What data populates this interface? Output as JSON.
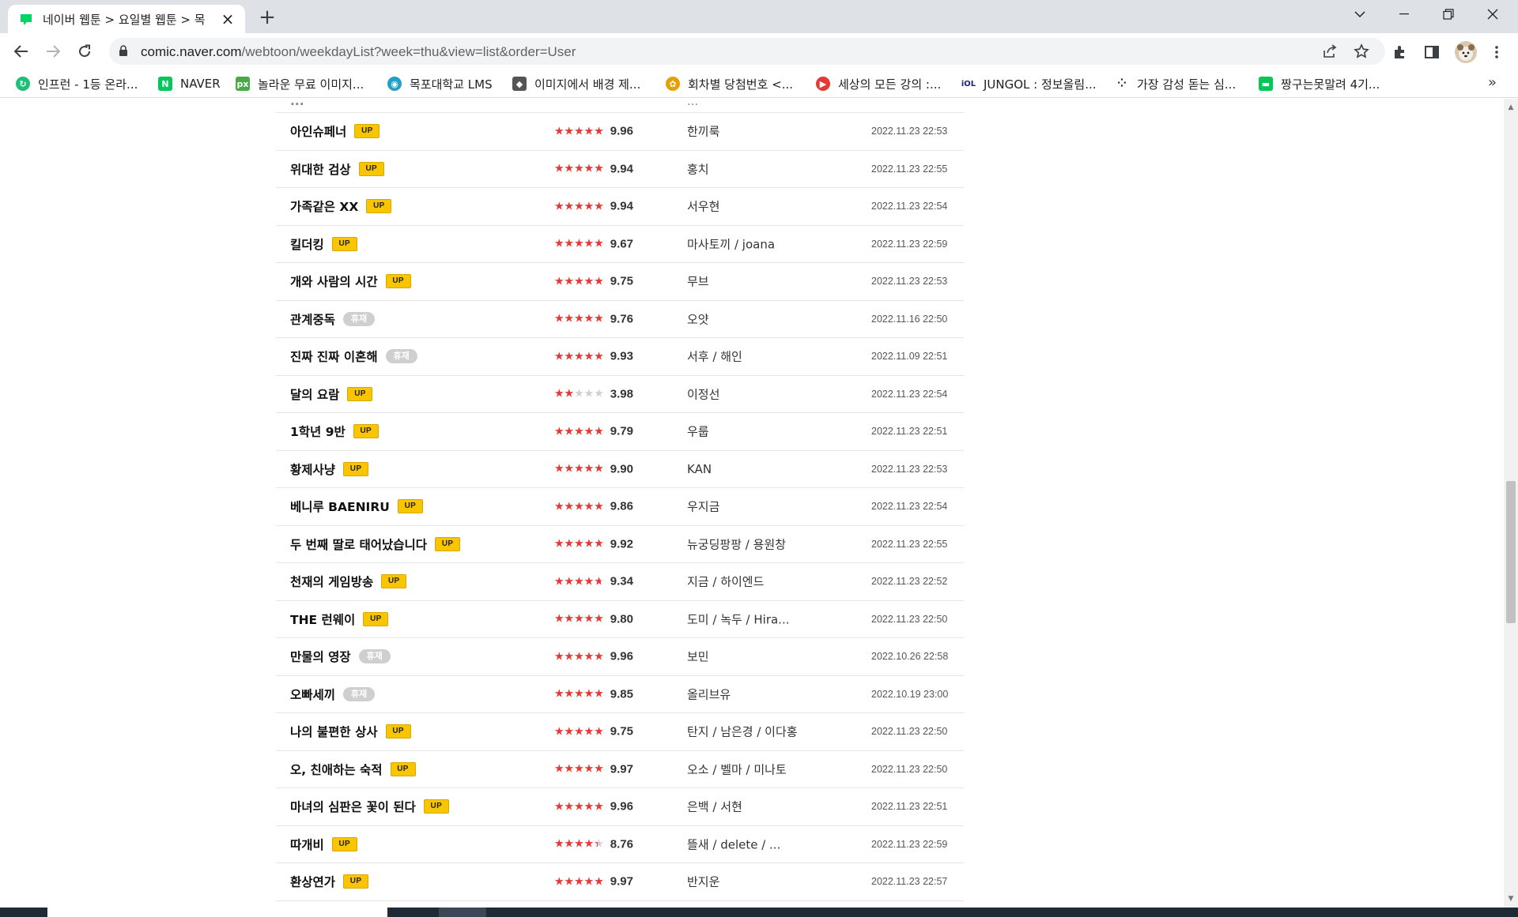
{
  "browser": {
    "tab_title": "네이버 웹툰 > 요일별 웹툰 > 목",
    "new_tab_label": "+",
    "url_host": "comic.naver.com",
    "url_path": "/webtoon/weekdayList?week=thu&view=list&order=User",
    "bookmarks": [
      {
        "label": "인프런 - 1등 온라...",
        "icon": "inflearn-icon",
        "color": "#1dc078"
      },
      {
        "label": "NAVER",
        "icon": "naver-icon",
        "color": "#03c75a"
      },
      {
        "label": "놀라운 무료 이미지...",
        "icon": "pixabay-icon",
        "color": "#48a947"
      },
      {
        "label": "목포대학교 LMS",
        "icon": "lms-icon",
        "color": "#21a0c6"
      },
      {
        "label": "이미지에서 배경 제...",
        "icon": "removebg-icon",
        "color": "#555555"
      },
      {
        "label": "회차별 당첨번호 <...",
        "icon": "lotto-icon",
        "color": "#e6a100"
      },
      {
        "label": "세상의 모든 강의 :...",
        "icon": "play-icon",
        "color": "#e53935"
      },
      {
        "label": "JUNGOL : 정보올림...",
        "icon": "jungol-icon",
        "color": "#1a237e"
      },
      {
        "label": "가장 감성 돋는 심...",
        "icon": "dots-icon",
        "color": "#222222"
      },
      {
        "label": "짱구는못말려 4기...",
        "icon": "line-icon",
        "color": "#06c755"
      }
    ],
    "bookmarks_more": "»"
  },
  "partial_row": {
    "title": "...",
    "author": "..."
  },
  "webtoons": [
    {
      "title": "아인슈페너",
      "badge": "UP",
      "rating": 9.96,
      "score": "9.96",
      "author": "한끼룩",
      "date": "2022.11.23 22:53"
    },
    {
      "title": "위대한 검상",
      "badge": "UP",
      "rating": 9.94,
      "score": "9.94",
      "author": "홍치",
      "date": "2022.11.23 22:55"
    },
    {
      "title": "가족같은 XX",
      "badge": "UP",
      "rating": 9.94,
      "score": "9.94",
      "author": "서우현",
      "date": "2022.11.23 22:54"
    },
    {
      "title": "킬더킹",
      "badge": "UP",
      "rating": 9.67,
      "score": "9.67",
      "author": "마사토끼 / joana",
      "date": "2022.11.23 22:59"
    },
    {
      "title": "개와 사람의 시간",
      "badge": "UP",
      "rating": 9.75,
      "score": "9.75",
      "author": "무브",
      "date": "2022.11.23 22:53"
    },
    {
      "title": "관계중독",
      "badge": "휴재",
      "rating": 9.76,
      "score": "9.76",
      "author": "오얏",
      "date": "2022.11.16 22:50"
    },
    {
      "title": "진짜 진짜 이혼해",
      "badge": "휴재",
      "rating": 9.93,
      "score": "9.93",
      "author": "서후 / 해인",
      "date": "2022.11.09 22:51"
    },
    {
      "title": "달의 요람",
      "badge": "UP",
      "rating": 3.98,
      "score": "3.98",
      "author": "이정선",
      "date": "2022.11.23 22:54"
    },
    {
      "title": "1학년 9반",
      "badge": "UP",
      "rating": 9.79,
      "score": "9.79",
      "author": "우룹",
      "date": "2022.11.23 22:51"
    },
    {
      "title": "황제사냥",
      "badge": "UP",
      "rating": 9.9,
      "score": "9.90",
      "author": "KAN",
      "date": "2022.11.23 22:53"
    },
    {
      "title": "베니루 BAENIRU",
      "badge": "UP",
      "rating": 9.86,
      "score": "9.86",
      "author": "우지금",
      "date": "2022.11.23 22:54"
    },
    {
      "title": "두 번째 딸로 태어났습니다",
      "badge": "UP",
      "rating": 9.92,
      "score": "9.92",
      "author": "뉴궁딩팡팡 / 용원창",
      "date": "2022.11.23 22:55"
    },
    {
      "title": "천재의 게임방송",
      "badge": "UP",
      "rating": 9.34,
      "score": "9.34",
      "author": "지금 / 하이엔드",
      "date": "2022.11.23 22:52"
    },
    {
      "title": "THE 런웨이",
      "badge": "UP",
      "rating": 9.8,
      "score": "9.80",
      "author": "도미 / 녹두 / Hira...",
      "date": "2022.11.23 22:50"
    },
    {
      "title": "만물의 영장",
      "badge": "휴재",
      "rating": 9.96,
      "score": "9.96",
      "author": "보민",
      "date": "2022.10.26 22:58"
    },
    {
      "title": "오빠세끼",
      "badge": "휴재",
      "rating": 9.85,
      "score": "9.85",
      "author": "올리브유",
      "date": "2022.10.19 23:00"
    },
    {
      "title": "나의 불편한 상사",
      "badge": "UP",
      "rating": 9.75,
      "score": "9.75",
      "author": "탄지 / 남은경 / 이다홍",
      "date": "2022.11.23 22:50"
    },
    {
      "title": "오, 친애하는 숙적",
      "badge": "UP",
      "rating": 9.97,
      "score": "9.97",
      "author": "오소 / 벨마 / 미나토",
      "date": "2022.11.23 22:50"
    },
    {
      "title": "마녀의 심판은 꽃이 된다",
      "badge": "UP",
      "rating": 9.96,
      "score": "9.96",
      "author": "은백 / 서현",
      "date": "2022.11.23 22:51"
    },
    {
      "title": "따개비",
      "badge": "UP",
      "rating": 8.76,
      "score": "8.76",
      "author": "뜰새 / delete / ...",
      "date": "2022.11.23 22:59"
    },
    {
      "title": "환상연가",
      "badge": "UP",
      "rating": 9.97,
      "score": "9.97",
      "author": "반지운",
      "date": "2022.11.23 22:57"
    }
  ],
  "colors": {
    "star": "#e53935",
    "up_badge": "#f9c500",
    "rest_badge": "#cfcfcf"
  }
}
